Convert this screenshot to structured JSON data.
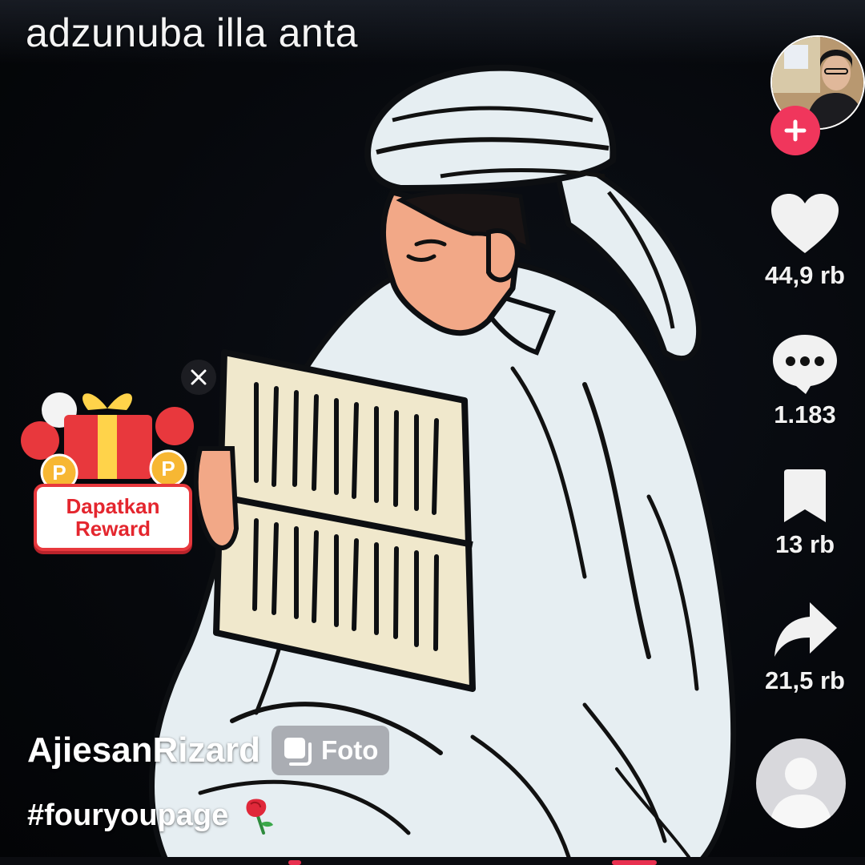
{
  "video": {
    "overlay_text": "adzunuba illa anta"
  },
  "creator": {
    "username": "AjiesanRizard",
    "post_type_label": "Foto"
  },
  "caption": {
    "hashtag": "#fouryoupage",
    "emoji": "🌹"
  },
  "actions": {
    "likes": "44,9 rb",
    "comments": "1.183",
    "bookmarks": "13 rb",
    "shares": "21,5 rb"
  },
  "reward": {
    "line1": "Dapatkan",
    "line2": "Reward"
  },
  "colors": {
    "accent": "#f0365c",
    "reward_red": "#e4262e",
    "background": "#05070b"
  },
  "icons": [
    "heart-icon",
    "comment-icon",
    "bookmark-icon",
    "share-icon",
    "plus-icon",
    "close-icon",
    "photo-stack-icon",
    "user-icon"
  ]
}
